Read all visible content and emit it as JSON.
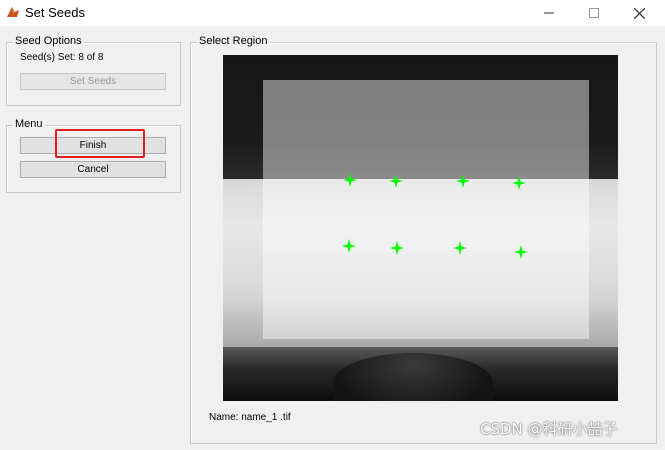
{
  "window": {
    "title": "Set Seeds"
  },
  "seed_options": {
    "label": "Seed Options",
    "status": "Seed(s) Set: 8 of 8",
    "set_seeds_label": "Set Seeds"
  },
  "menu": {
    "label": "Menu",
    "finish_label": "Finish",
    "cancel_label": "Cancel"
  },
  "select_region": {
    "label": "Select Region",
    "image_name": "Name: name_1 .tif"
  },
  "seed_color": "#00ff00",
  "highlight_color": "#e02020",
  "watermark": "CSDN @科研小喆子"
}
